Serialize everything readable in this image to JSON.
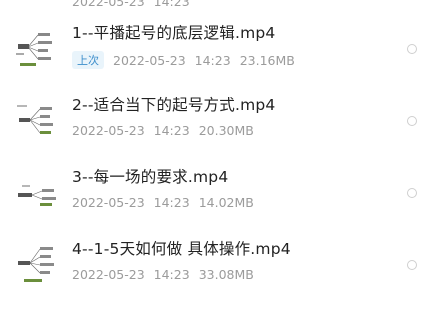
{
  "previous_row": {
    "date": "2022-05-23",
    "time": "14:23"
  },
  "files": [
    {
      "name": "1--平播起号的底层逻辑.mp4",
      "badge": "上次",
      "date": "2022-05-23",
      "time": "14:23",
      "size": "23.16MB",
      "thumbnail_icon": "mindmap-thumbnail-icon"
    },
    {
      "name": "2--适合当下的起号方式.mp4",
      "date": "2022-05-23",
      "time": "14:23",
      "size": "20.30MB",
      "thumbnail_icon": "mindmap-thumbnail-icon"
    },
    {
      "name": "3--每一场的要求.mp4",
      "date": "2022-05-23",
      "time": "14:23",
      "size": "14.02MB",
      "thumbnail_icon": "mindmap-thumbnail-icon"
    },
    {
      "name": "4--1-5天如何做 具体操作.mp4",
      "date": "2022-05-23",
      "time": "14:23",
      "size": "33.08MB",
      "thumbnail_icon": "mindmap-thumbnail-icon"
    }
  ],
  "colors": {
    "badge_bg": "#e9f4fb",
    "badge_text": "#3d8ecb",
    "meta_text": "#9b9b9b",
    "title_text": "#222222"
  }
}
